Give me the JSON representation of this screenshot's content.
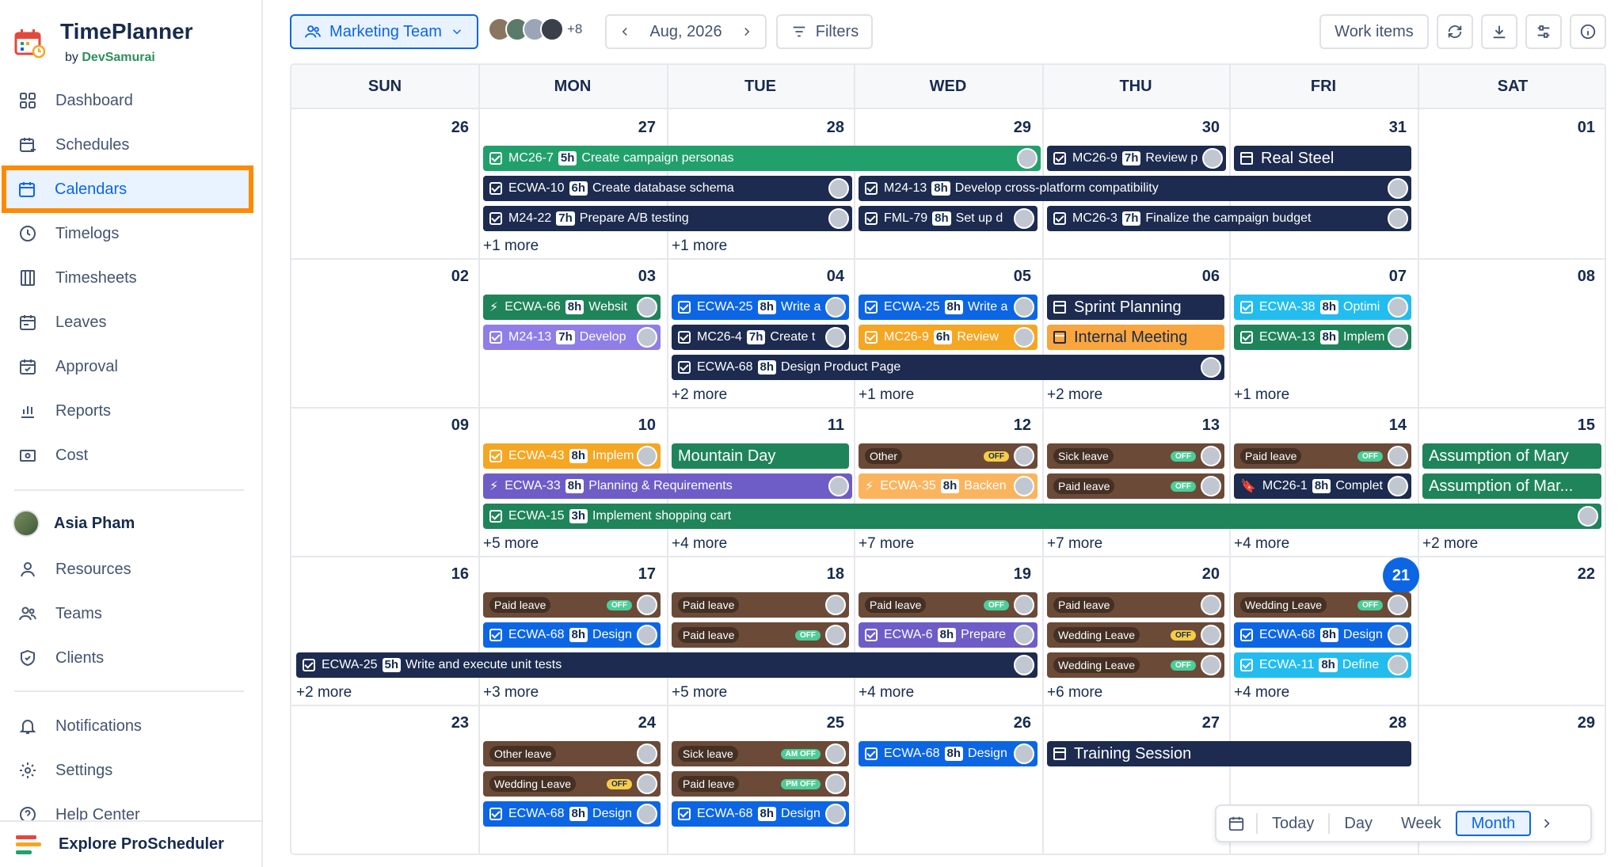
{
  "app": {
    "name": "TimePlanner",
    "by": "by",
    "vendor": "DevSamurai"
  },
  "sidebar": {
    "items": [
      {
        "label": "Dashboard",
        "icon": "grid-icon"
      },
      {
        "label": "Schedules",
        "icon": "calendar-plus-icon"
      },
      {
        "label": "Calendars",
        "icon": "calendar-icon"
      },
      {
        "label": "Timelogs",
        "icon": "clock-icon"
      },
      {
        "label": "Timesheets",
        "icon": "columns-icon"
      },
      {
        "label": "Leaves",
        "icon": "calendar-leave-icon"
      },
      {
        "label": "Approval",
        "icon": "calendar-check-icon"
      },
      {
        "label": "Reports",
        "icon": "bar-chart-icon"
      },
      {
        "label": "Cost",
        "icon": "cost-icon"
      }
    ],
    "user": "Asia Pham",
    "people_items": [
      {
        "label": "Resources",
        "icon": "person-icon"
      },
      {
        "label": "Teams",
        "icon": "people-icon"
      },
      {
        "label": "Clients",
        "icon": "shield-icon"
      }
    ],
    "bottom_items": [
      {
        "label": "Notifications",
        "icon": "bell-icon"
      },
      {
        "label": "Settings",
        "icon": "gear-icon"
      },
      {
        "label": "Help Center",
        "icon": "help-icon"
      }
    ],
    "explore": "Explore ProScheduler"
  },
  "toolbar": {
    "team": "Marketing Team",
    "extra_members": "+8",
    "month": "Aug, 2026",
    "filters": "Filters",
    "work_items": "Work items"
  },
  "calendar": {
    "weekdays": [
      "SUN",
      "MON",
      "TUE",
      "WED",
      "THU",
      "FRI",
      "SAT"
    ],
    "weeks": [
      [
        "26",
        "27",
        "28",
        "29",
        "30",
        "31",
        "01"
      ],
      [
        "02",
        "03",
        "04",
        "05",
        "06",
        "07",
        "08"
      ],
      [
        "09",
        "10",
        "11",
        "12",
        "13",
        "14",
        "15"
      ],
      [
        "16",
        "17",
        "18",
        "19",
        "20",
        "21",
        "22"
      ],
      [
        "23",
        "24",
        "25",
        "26",
        "27",
        "28",
        "29"
      ]
    ],
    "today": "21",
    "events": {
      "w1": [
        {
          "key": "MC26-7",
          "hours": "5h",
          "title": "Create campaign personas"
        },
        {
          "key": "MC26-9",
          "hours": "7h",
          "title": "Review p"
        },
        {
          "title": "Real Steel"
        },
        {
          "key": "ECWA-10",
          "hours": "6h",
          "title": "Create database schema"
        },
        {
          "key": "M24-13",
          "hours": "8h",
          "title": "Develop cross-platform compatibility"
        },
        {
          "key": "M24-22",
          "hours": "7h",
          "title": "Prepare A/B testing"
        },
        {
          "key": "FML-79",
          "hours": "8h",
          "title": "Set up d"
        },
        {
          "key": "MC26-3",
          "hours": "7h",
          "title": "Finalize the campaign budget"
        }
      ],
      "w2": [
        {
          "key": "ECWA-66",
          "hours": "8h",
          "title": "Websit"
        },
        {
          "key": "ECWA-25",
          "hours": "8h",
          "title": "Write a"
        },
        {
          "key": "ECWA-25",
          "hours": "8h",
          "title": "Write a"
        },
        {
          "title": "Sprint Planning"
        },
        {
          "key": "ECWA-38",
          "hours": "8h",
          "title": "Optimi"
        },
        {
          "key": "M24-13",
          "hours": "7h",
          "title": "Develop"
        },
        {
          "key": "MC26-4",
          "hours": "7h",
          "title": "Create t"
        },
        {
          "key": "MC26-9",
          "hours": "6h",
          "title": "Review"
        },
        {
          "title": "Internal Meeting"
        },
        {
          "key": "ECWA-13",
          "hours": "8h",
          "title": "Implem"
        },
        {
          "key": "ECWA-68",
          "hours": "8h",
          "title": "Design Product Page"
        }
      ],
      "w3": [
        {
          "key": "ECWA-43",
          "hours": "8h",
          "title": "Implem"
        },
        {
          "title": "Mountain Day"
        },
        {
          "leave": "Other",
          "off": "OFF"
        },
        {
          "leave": "Sick leave",
          "off": "OFF"
        },
        {
          "leave": "Paid leave",
          "off": "OFF"
        },
        {
          "title": "Assumption of Mary"
        },
        {
          "key": "ECWA-33",
          "hours": "8h",
          "title": "Planning & Requirements"
        },
        {
          "key": "ECWA-35",
          "hours": "8h",
          "title": "Backen"
        },
        {
          "leave": "Paid leave",
          "off": "OFF"
        },
        {
          "key": "MC26-1",
          "hours": "8h",
          "title": "Complet"
        },
        {
          "title": "Assumption of Mar..."
        },
        {
          "key": "ECWA-15",
          "hours": "3h",
          "title": "Implement shopping cart"
        }
      ],
      "w4": [
        {
          "leave": "Paid leave",
          "off": "OFF"
        },
        {
          "leave": "Paid leave"
        },
        {
          "leave": "Paid leave",
          "off": "OFF"
        },
        {
          "leave": "Paid leave"
        },
        {
          "leave": "Wedding Leave",
          "off": "OFF"
        },
        {
          "key": "ECWA-68",
          "hours": "8h",
          "title": "Design"
        },
        {
          "leave": "Paid leave",
          "off": "OFF"
        },
        {
          "key": "ECWA-6",
          "hours": "8h",
          "title": "Prepare"
        },
        {
          "leave": "Wedding Leave",
          "off": "OFF"
        },
        {
          "key": "ECWA-68",
          "hours": "8h",
          "title": "Design"
        },
        {
          "key": "ECWA-25",
          "hours": "5h",
          "title": "Write and execute unit tests"
        },
        {
          "leave": "Wedding Leave",
          "off": "OFF"
        },
        {
          "key": "ECWA-11",
          "hours": "8h",
          "title": "Define"
        }
      ],
      "w5": [
        {
          "leave": "Other leave"
        },
        {
          "leave": "Sick leave",
          "off": "AM OFF"
        },
        {
          "key": "ECWA-68",
          "hours": "8h",
          "title": "Design"
        },
        {
          "title": "Training Session"
        },
        {
          "leave": "Wedding Leave",
          "off": "OFF"
        },
        {
          "leave": "Paid leave",
          "off": "PM OFF"
        },
        {
          "key": "ECWA-68",
          "hours": "8h",
          "title": "Design"
        },
        {
          "key": "ECWA-68",
          "hours": "8h",
          "title": "Design"
        }
      ]
    },
    "more": {
      "w1_mon": "+1 more",
      "w1_tue": "+1 more",
      "w2_tue": "+2 more",
      "w2_wed": "+1 more",
      "w2_thu": "+2 more",
      "w2_fri": "+1 more",
      "w3_mon": "+5 more",
      "w3_tue": "+4 more",
      "w3_wed": "+7 more",
      "w3_thu": "+7 more",
      "w3_fri": "+4 more",
      "w3_sat": "+2 more",
      "w4_sun": "+2 more",
      "w4_mon": "+3 more",
      "w4_tue": "+5 more",
      "w4_wed": "+4 more",
      "w4_thu": "+6 more",
      "w4_fri": "+4 more"
    }
  },
  "view_switch": {
    "today": "Today",
    "day": "Day",
    "week": "Week",
    "month": "Month",
    "active": "Month"
  }
}
